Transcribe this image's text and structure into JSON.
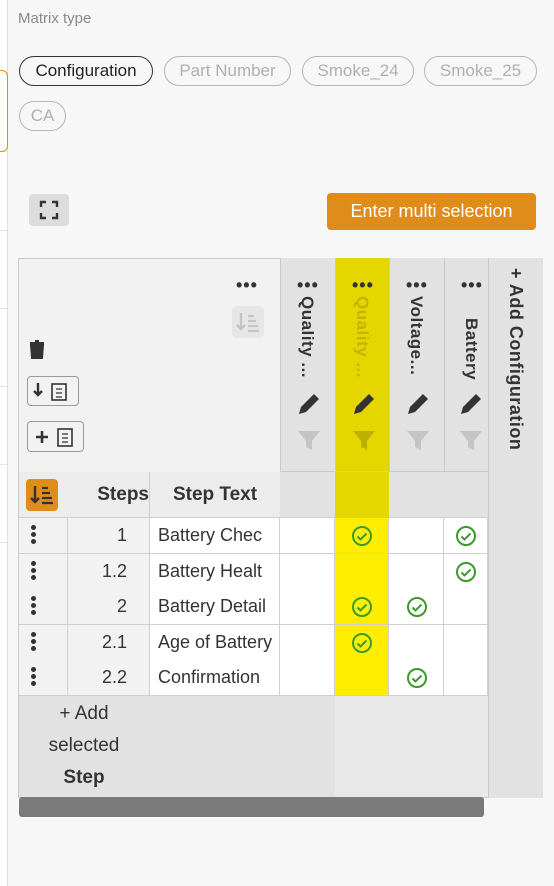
{
  "matrix": {
    "label": "Matrix type",
    "chips": [
      {
        "label": "Configuration",
        "active": true
      },
      {
        "label": "Part Number",
        "active": false
      },
      {
        "label": "Smoke_24",
        "active": false
      },
      {
        "label": "Smoke_25",
        "active": false
      },
      {
        "label": "CA",
        "active": false
      }
    ]
  },
  "toolbar": {
    "expand_icon": "expand-icon",
    "multi_selection_label": "Enter multi selection"
  },
  "table": {
    "columns_header": {
      "steps": "Steps",
      "step_text": "Step Text"
    },
    "config_columns": [
      {
        "label": "Quality ...",
        "highlighted": false
      },
      {
        "label": "Quality ...",
        "highlighted": true
      },
      {
        "label": "Voltage...",
        "highlighted": false
      },
      {
        "label": "Battery",
        "highlighted": false
      }
    ],
    "add_configuration": "+ Add Configuration",
    "more_dots": "•••",
    "rows": [
      {
        "step": "1",
        "text": "Battery Chec",
        "checks": [
          false,
          true,
          false,
          true
        ]
      },
      {
        "step": "1.2",
        "text": "Battery Healt",
        "checks": [
          false,
          false,
          false,
          true
        ]
      },
      {
        "step": "2",
        "text": "Battery Detail",
        "checks": [
          false,
          true,
          true,
          false
        ]
      },
      {
        "step": "2.1",
        "text": "Age of Battery",
        "checks": [
          false,
          true,
          false,
          false
        ]
      },
      {
        "step": "2.2",
        "text": "Confirmation",
        "checks": [
          false,
          false,
          true,
          false
        ]
      }
    ],
    "add_step_line1": "+ Add",
    "add_step_line2": "selected",
    "add_step_line3": "Step"
  },
  "colors": {
    "accent": "#e08c1a",
    "highlight": "#ffee00",
    "check": "#3a9a2a"
  }
}
